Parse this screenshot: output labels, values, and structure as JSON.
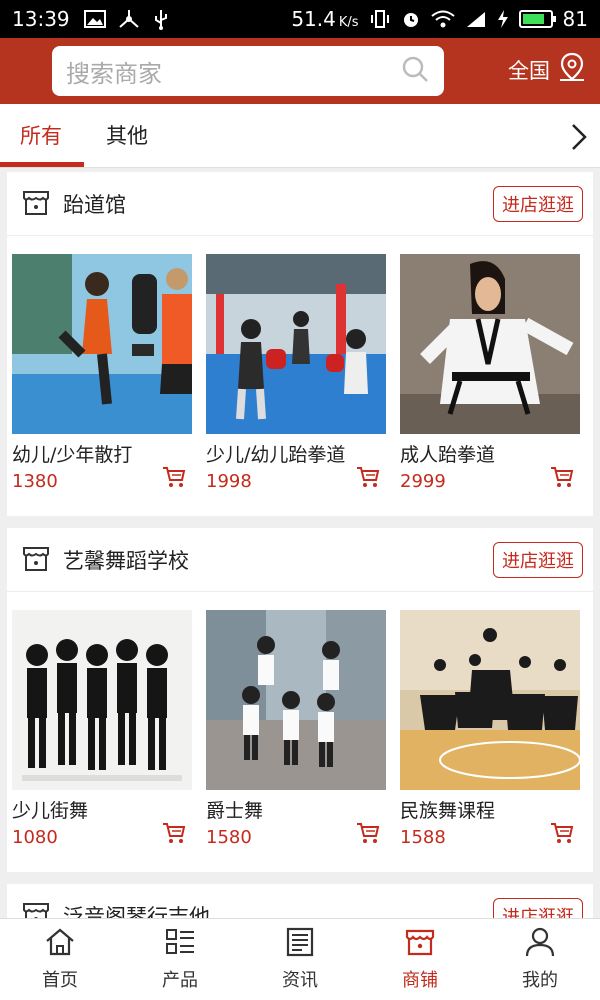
{
  "status_bar": {
    "time": "13:39",
    "network_speed": "51.4",
    "speed_unit": "K/s",
    "battery_level": "81",
    "battery_fraction": 0.81
  },
  "search": {
    "placeholder": "搜索商家"
  },
  "region": {
    "label": "全国"
  },
  "tabs": [
    {
      "label": "所有",
      "active": true
    },
    {
      "label": "其他",
      "active": false
    }
  ],
  "stores": [
    {
      "name": "跆道馆",
      "enter_label": "进店逛逛",
      "products": [
        {
          "name": "幼儿/少年散打",
          "price": "1380"
        },
        {
          "name": "少儿/幼儿跆拳道",
          "price": "1998"
        },
        {
          "name": "成人跆拳道",
          "price": "2999"
        }
      ]
    },
    {
      "name": "艺馨舞蹈学校",
      "enter_label": "进店逛逛",
      "products": [
        {
          "name": "少儿街舞",
          "price": "1080"
        },
        {
          "name": "爵士舞",
          "price": "1580"
        },
        {
          "name": "民族舞课程",
          "price": "1588"
        }
      ]
    },
    {
      "name": "泛音阁琴行吉他",
      "enter_label": "进店逛逛",
      "products": []
    }
  ],
  "bottom_nav": [
    {
      "label": "首页",
      "icon": "home-icon",
      "active": false
    },
    {
      "label": "产品",
      "icon": "grid-list-icon",
      "active": false
    },
    {
      "label": "资讯",
      "icon": "news-icon",
      "active": false
    },
    {
      "label": "商铺",
      "icon": "store-icon",
      "active": true
    },
    {
      "label": "我的",
      "icon": "user-icon",
      "active": false
    }
  ],
  "colors": {
    "brand": "#b5341f",
    "accent": "#c42b1c"
  }
}
